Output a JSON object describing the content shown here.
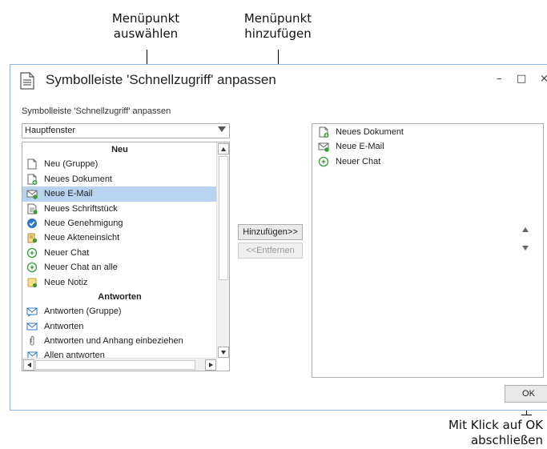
{
  "annotations": {
    "select_item": [
      "Menüpunkt",
      "auswählen"
    ],
    "add_item": [
      "Menüpunkt",
      "hinzufügen"
    ],
    "finish": [
      "Mit Klick auf OK",
      "abschließen"
    ]
  },
  "dialog": {
    "title": "Symbolleiste 'Schnellzugriff' anpassen",
    "subtitle": "Symbolleiste 'Schnellzugriff' anpassen",
    "window_controls": {
      "minimize": "–",
      "maximize": "□",
      "close": "×"
    },
    "category_select": {
      "value": "Hauptfenster"
    },
    "available_commands": [
      {
        "type": "header",
        "label": "Neu"
      },
      {
        "label": "Neu (Gruppe)",
        "icon": "blank-document-icon"
      },
      {
        "label": "Neues Dokument",
        "icon": "new-document-icon"
      },
      {
        "label": "Neue E-Mail",
        "icon": "new-email-icon",
        "selected": true
      },
      {
        "label": "Neues Schriftstück",
        "icon": "new-letter-icon"
      },
      {
        "label": "Neue Genehmigung",
        "icon": "approval-check-icon"
      },
      {
        "label": "Neue Akteneinsicht",
        "icon": "file-inspection-icon"
      },
      {
        "label": "Neuer Chat",
        "icon": "chat-icon"
      },
      {
        "label": "Neuer Chat an alle",
        "icon": "chat-all-icon"
      },
      {
        "label": "Neue Notiz",
        "icon": "note-icon"
      },
      {
        "type": "header",
        "label": "Antworten"
      },
      {
        "label": "Antworten (Gruppe)",
        "icon": "reply-group-icon"
      },
      {
        "label": "Antworten",
        "icon": "reply-icon"
      },
      {
        "label": "Antworten und Anhang einbeziehen",
        "icon": "paperclip-icon"
      },
      {
        "label": "Allen antworten",
        "icon": "reply-all-icon"
      }
    ],
    "add_button": "Hinzufügen>>",
    "remove_button": "<<Entfernen",
    "toolbar_commands": [
      {
        "label": "Neues Dokument",
        "icon": "new-document-icon"
      },
      {
        "label": "Neue E-Mail",
        "icon": "new-email-icon"
      },
      {
        "label": "Neuer Chat",
        "icon": "chat-icon"
      }
    ],
    "ok_button": "OK"
  },
  "colors": {
    "selection": "#b7d3f0",
    "accent_blue": "#2b78c4",
    "icon_green": "#3a9a3a",
    "icon_gold": "#e8b33a"
  }
}
